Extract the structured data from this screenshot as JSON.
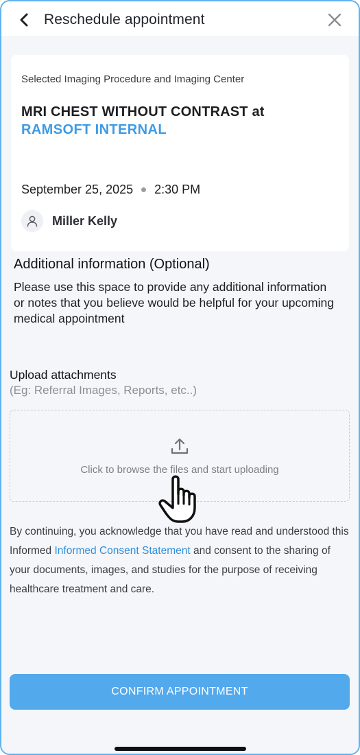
{
  "header": {
    "title": "Reschedule appointment",
    "back_icon": "chevron-left-icon",
    "close_icon": "close-icon"
  },
  "appointment_card": {
    "caption": "Selected Imaging Procedure and Imaging Center",
    "procedure": "MRI CHEST WITHOUT CONTRAST at",
    "center": "RAMSOFT INTERNAL",
    "date": "September 25, 2025",
    "time": "2:30 PM",
    "provider": "Miller Kelly",
    "provider_icon": "user-icon"
  },
  "additional_info": {
    "title": "Additional information (Optional)",
    "description": "Please use this space to provide any additional information or notes that you believe would be helpful for your upcoming medical appointment"
  },
  "upload": {
    "title": "Upload attachments",
    "hint": "(Eg: Referral Images, Reports, etc..)",
    "dropzone_label": "Click to browse the files and start uploading",
    "icon": "upload-icon"
  },
  "consent": {
    "part1": "By continuing, you acknowledge that you have read and understood this Informed ",
    "link": "Informed Consent Statement",
    "part2": " and consent to the sharing of your documents, images, and studies for the purpose of receiving healthcare treatment and care."
  },
  "footer": {
    "confirm_label": "CONFIRM APPOINTMENT"
  },
  "colors": {
    "accent": "#3d9be6",
    "button": "#52a9ec",
    "frame": "#5fb2ee"
  }
}
